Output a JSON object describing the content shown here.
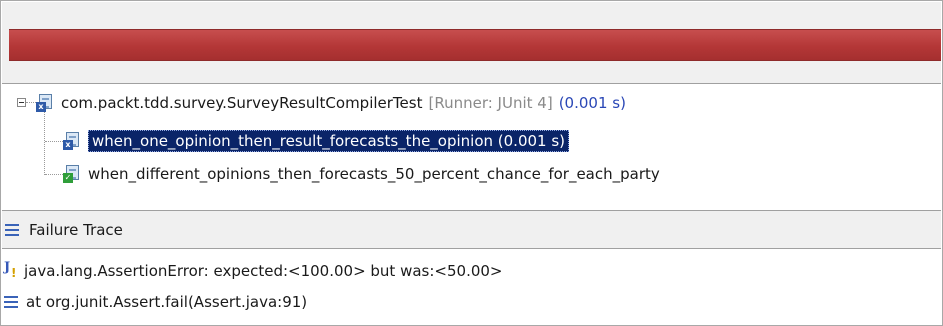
{
  "status": {
    "bar_color": "#b53a3a",
    "result": "failure"
  },
  "tree": {
    "root": {
      "name": "com.packt.tdd.survey.SurveyResultCompilerTest",
      "runner": "[Runner: JUnit 4]",
      "time": "(0.001 s)",
      "icon": "test-suite-failed-icon"
    },
    "children": [
      {
        "label": "when_one_opinion_then_result_forecasts_the_opinion (0.001 s)",
        "status": "failed",
        "selected": true,
        "icon": "test-failed-icon"
      },
      {
        "label": "when_different_opinions_then_forecasts_50_percent_chance_for_each_party",
        "status": "passed",
        "selected": false,
        "icon": "test-passed-icon"
      }
    ]
  },
  "failure_trace": {
    "title": "Failure Trace",
    "lines": [
      {
        "text": "java.lang.AssertionError: expected:<100.00> but was:<50.00>",
        "icon": "exception-icon"
      },
      {
        "text": "at org.junit.Assert.fail(Assert.java:91)",
        "icon": "stack-frame-icon"
      }
    ]
  },
  "colors": {
    "selection": "#0a2468",
    "link_blue": "#2a47b6",
    "accent": "#3a63b8"
  }
}
